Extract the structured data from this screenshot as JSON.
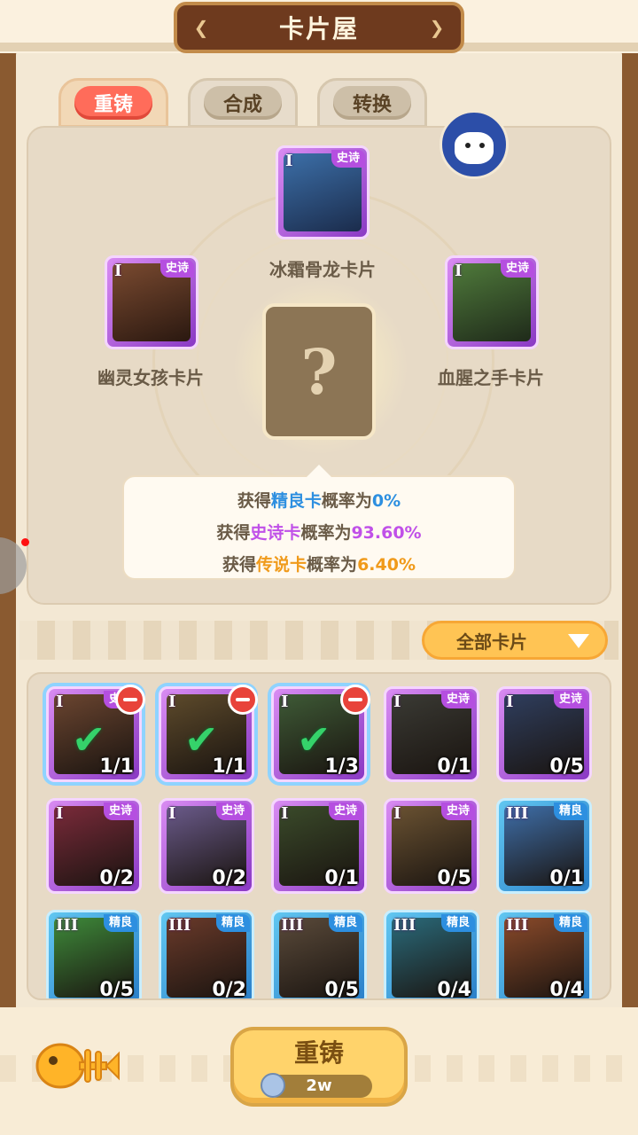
{
  "title": "卡片屋",
  "tabs": [
    {
      "label": "重铸",
      "active": true
    },
    {
      "label": "合成",
      "active": false
    },
    {
      "label": "转换",
      "active": false
    }
  ],
  "slots": {
    "top": {
      "tier": "I",
      "rarity": "史诗",
      "name": "冰霜骨龙卡片"
    },
    "left": {
      "tier": "I",
      "rarity": "史诗",
      "name": "幽灵女孩卡片"
    },
    "right": {
      "tier": "I",
      "rarity": "史诗",
      "name": "血腥之手卡片"
    },
    "result": "?"
  },
  "probability": {
    "line1": {
      "prefix": "获得",
      "card": "精良卡",
      "mid": "概率为",
      "value": "0%"
    },
    "line2": {
      "prefix": "获得",
      "card": "史诗卡",
      "mid": "概率为",
      "value": "93.60%"
    },
    "line3": {
      "prefix": "获得",
      "card": "传说卡",
      "mid": "概率为",
      "value": "6.40%"
    }
  },
  "filter": {
    "label": "全部卡片"
  },
  "cards": [
    {
      "tier": "I",
      "rarity": "史诗",
      "count": "1/1",
      "selected": true
    },
    {
      "tier": "I",
      "rarity": "",
      "count": "1/1",
      "selected": true
    },
    {
      "tier": "I",
      "rarity": "",
      "count": "1/3",
      "selected": true
    },
    {
      "tier": "I",
      "rarity": "史诗",
      "count": "0/1",
      "selected": false
    },
    {
      "tier": "I",
      "rarity": "史诗",
      "count": "0/5",
      "selected": false
    },
    {
      "tier": "I",
      "rarity": "史诗",
      "count": "0/2",
      "selected": false
    },
    {
      "tier": "I",
      "rarity": "史诗",
      "count": "0/2",
      "selected": false
    },
    {
      "tier": "I",
      "rarity": "史诗",
      "count": "0/1",
      "selected": false
    },
    {
      "tier": "I",
      "rarity": "史诗",
      "count": "0/5",
      "selected": false
    },
    {
      "tier": "III",
      "rarity": "精良",
      "count": "0/1",
      "selected": false
    },
    {
      "tier": "III",
      "rarity": "精良",
      "count": "0/5",
      "selected": false
    },
    {
      "tier": "III",
      "rarity": "精良",
      "count": "0/2",
      "selected": false
    },
    {
      "tier": "III",
      "rarity": "精良",
      "count": "0/5",
      "selected": false
    },
    {
      "tier": "III",
      "rarity": "精良",
      "count": "0/4",
      "selected": false
    },
    {
      "tier": "III",
      "rarity": "精良",
      "count": "0/4",
      "selected": false
    }
  ],
  "action": {
    "label": "重铸",
    "cost": "2w"
  },
  "colors": {
    "fine": "#2d8fe0",
    "epic": "#c050e8",
    "legend": "#f09a1a",
    "tab_active": "#ff6c5a",
    "button": "#ffd36b"
  }
}
